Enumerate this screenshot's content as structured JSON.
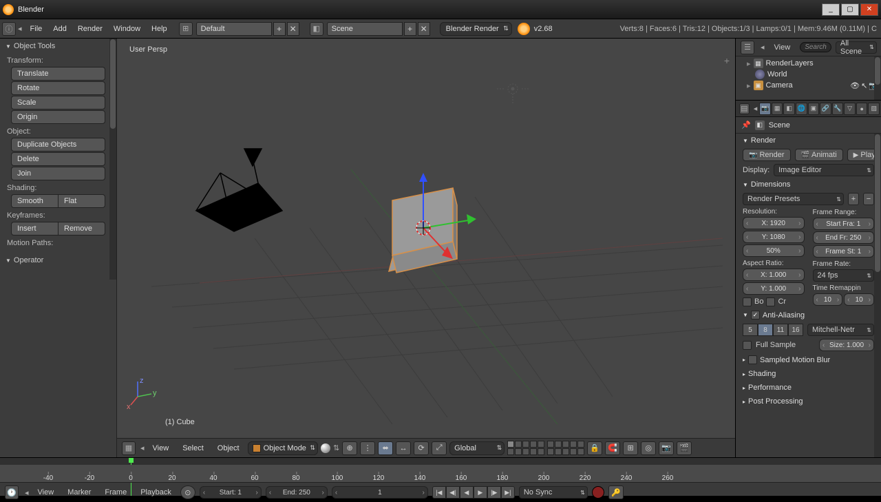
{
  "titlebar": {
    "title": "Blender"
  },
  "winctrl": {
    "min": "_",
    "max": "▢",
    "close": "✕"
  },
  "menubar": {
    "items": [
      "File",
      "Add",
      "Render",
      "Window",
      "Help"
    ],
    "layout": "Default",
    "scene": "Scene",
    "engine": "Blender Render",
    "version": "v2.68",
    "stats": "Verts:8 | Faces:6 | Tris:12 | Objects:1/3 | Lamps:0/1 | Mem:9.46M (0.11M) | C"
  },
  "toolshelf": {
    "obj_tools": "Object Tools",
    "transform_lbl": "Transform:",
    "translate": "Translate",
    "rotate": "Rotate",
    "scale": "Scale",
    "origin": "Origin",
    "object_lbl": "Object:",
    "dup": "Duplicate Objects",
    "delete": "Delete",
    "join": "Join",
    "shading_lbl": "Shading:",
    "smooth": "Smooth",
    "flat": "Flat",
    "keyframes_lbl": "Keyframes:",
    "insert": "Insert",
    "remove": "Remove",
    "motion_lbl": "Motion Paths:",
    "operator": "Operator"
  },
  "viewport": {
    "persp": "User Persp",
    "object_name": "(1) Cube"
  },
  "view3d_header": {
    "view": "View",
    "select": "Select",
    "object": "Object",
    "mode": "Object Mode",
    "orient": "Global"
  },
  "outliner": {
    "view": "View",
    "search": "Search",
    "filter": "All Scene",
    "renderlayers": "RenderLayers",
    "world": "World",
    "camera": "Camera"
  },
  "props": {
    "scene": "Scene",
    "render": "Render",
    "render_btn": "Render",
    "anim_btn": "Animati",
    "play_btn": "Play",
    "display_lbl": "Display:",
    "display_val": "Image Editor",
    "dims": "Dimensions",
    "render_presets": "Render Presets",
    "res_lbl": "Resolution:",
    "x": "X: 1920",
    "y": "Y: 1080",
    "pct": "50%",
    "aspect_lbl": "Aspect Ratio:",
    "ax": "X: 1.000",
    "ay": "Y: 1.000",
    "border": "Bo",
    "crop": "Cr",
    "frange_lbl": "Frame Range:",
    "fstart": "Start Fra: 1",
    "fend": "End Fr: 250",
    "fstep": "Frame St: 1",
    "frate_lbl": "Frame Rate:",
    "frate": "24 fps",
    "remap": "Time Remappin",
    "r1": "10",
    "r2": "10",
    "aa": "Anti-Aliasing",
    "aa5": "5",
    "aa8": "8",
    "aa11": "11",
    "aa16": "16",
    "filter": "Mitchell-Netr",
    "fullsample": "Full Sample",
    "pxsize": "Size: 1.000",
    "motion": "Sampled Motion Blur",
    "shading": "Shading",
    "perf": "Performance",
    "post": "Post Processing"
  },
  "timeline": {
    "view": "View",
    "marker": "Marker",
    "frame": "Frame",
    "playback": "Playback",
    "start": "Start: 1",
    "end": "End: 250",
    "cur": "1",
    "sync": "No Sync",
    "ticks": [
      -40,
      -20,
      0,
      20,
      40,
      60,
      80,
      100,
      120,
      140,
      160,
      180,
      200,
      220,
      240,
      260
    ]
  }
}
